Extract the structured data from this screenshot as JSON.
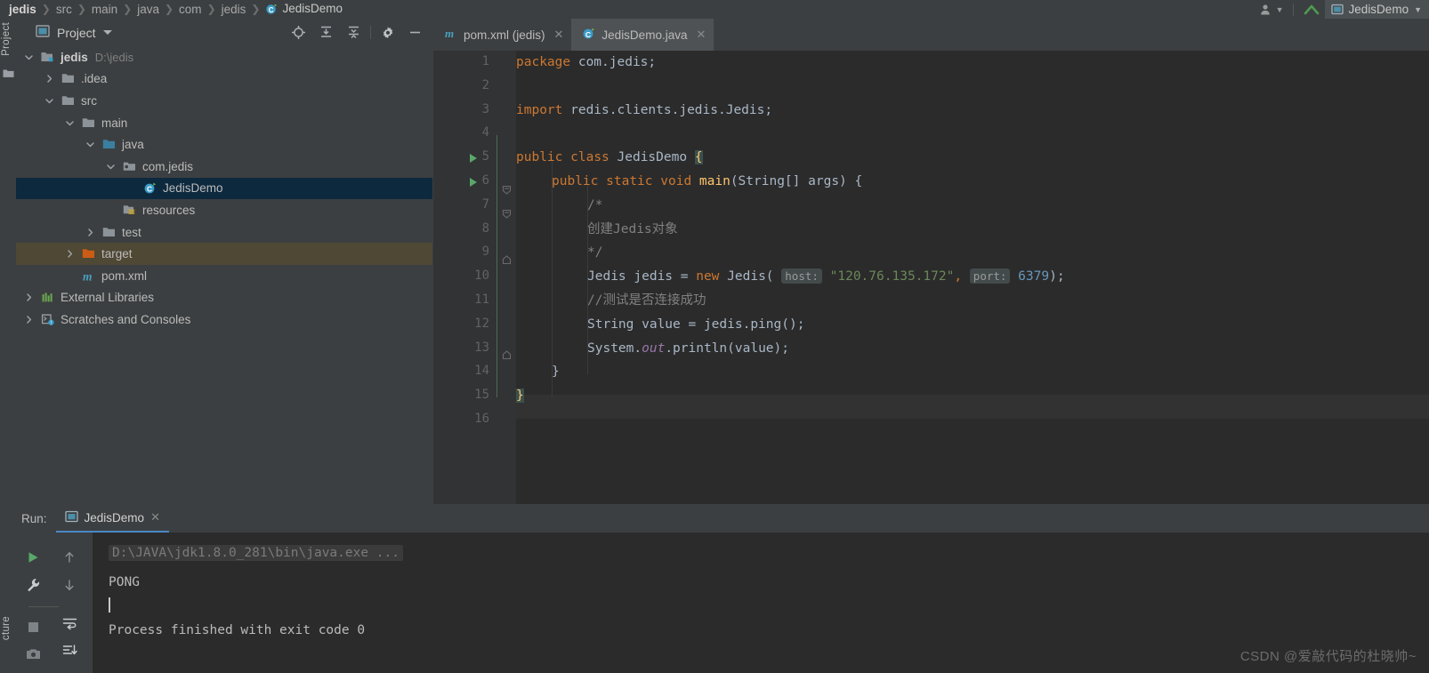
{
  "window": {
    "breadcrumbs": [
      "jedis",
      "src",
      "main",
      "java",
      "com",
      "jedis",
      "JedisDemo"
    ],
    "run_config_name": "JedisDemo",
    "accent_blue": "#4a88c7",
    "selection_navy": "#0d293e",
    "target_highlight": "#4e4834",
    "editor_bg": "#2b2b2b",
    "panel_bg": "#3c3f41"
  },
  "rail": {
    "project_label": "Project",
    "structure_label": "cture"
  },
  "project_panel": {
    "title": "Project",
    "tools": [
      "locate-icon",
      "expand-all-icon",
      "collapse-all-icon",
      "settings-icon",
      "hide-icon"
    ],
    "tree": [
      {
        "indent": 0,
        "arrow": "down",
        "icon": "module-folder",
        "label": "jedis",
        "bold": true,
        "location": "D:\\jedis",
        "state": "normal"
      },
      {
        "indent": 1,
        "arrow": "right",
        "icon": "folder",
        "label": ".idea",
        "bold": false,
        "location": "",
        "state": "normal"
      },
      {
        "indent": 1,
        "arrow": "down",
        "icon": "folder",
        "label": "src",
        "bold": false,
        "location": "",
        "state": "normal"
      },
      {
        "indent": 2,
        "arrow": "down",
        "icon": "folder",
        "label": "main",
        "bold": false,
        "location": "",
        "state": "normal"
      },
      {
        "indent": 3,
        "arrow": "down",
        "icon": "source-folder",
        "label": "java",
        "bold": false,
        "location": "",
        "state": "normal"
      },
      {
        "indent": 4,
        "arrow": "down",
        "icon": "package",
        "label": "com.jedis",
        "bold": false,
        "location": "",
        "state": "normal"
      },
      {
        "indent": 5,
        "arrow": "none",
        "icon": "java-class",
        "label": "JedisDemo",
        "bold": false,
        "location": "",
        "state": "selected"
      },
      {
        "indent": 4,
        "arrow": "none",
        "icon": "resource-folder",
        "label": "resources",
        "bold": false,
        "location": "",
        "state": "normal"
      },
      {
        "indent": 3,
        "arrow": "right",
        "icon": "folder",
        "label": "test",
        "bold": false,
        "location": "",
        "state": "normal"
      },
      {
        "indent": 2,
        "arrow": "right",
        "icon": "target-folder",
        "label": "target",
        "bold": false,
        "location": "",
        "state": "target"
      },
      {
        "indent": 2,
        "arrow": "none",
        "icon": "maven-file",
        "label": "pom.xml",
        "bold": false,
        "location": "",
        "state": "normal"
      },
      {
        "indent": 0,
        "arrow": "right",
        "icon": "libraries",
        "label": "External Libraries",
        "bold": false,
        "location": "",
        "state": "normal"
      },
      {
        "indent": 0,
        "arrow": "right",
        "icon": "scratches",
        "label": "Scratches and Consoles",
        "bold": false,
        "location": "",
        "state": "normal"
      }
    ]
  },
  "editor": {
    "tabs": [
      {
        "label": "pom.xml (jedis)",
        "icon": "maven-file",
        "active": false
      },
      {
        "label": "JedisDemo.java",
        "icon": "java-class",
        "active": true
      }
    ],
    "current_line": 15,
    "gutter_run_lines": [
      5,
      6
    ],
    "lines": [
      {
        "n": 1,
        "indent": 0
      },
      {
        "n": 2,
        "indent": 0
      },
      {
        "n": 3,
        "indent": 0
      },
      {
        "n": 4,
        "indent": 0
      },
      {
        "n": 5,
        "indent": 0
      },
      {
        "n": 6,
        "indent": 1
      },
      {
        "n": 7,
        "indent": 2
      },
      {
        "n": 8,
        "indent": 2
      },
      {
        "n": 9,
        "indent": 2
      },
      {
        "n": 10,
        "indent": 2
      },
      {
        "n": 11,
        "indent": 2
      },
      {
        "n": 12,
        "indent": 2
      },
      {
        "n": 13,
        "indent": 2
      },
      {
        "n": 14,
        "indent": 1
      },
      {
        "n": 15,
        "indent": 0
      },
      {
        "n": 16,
        "indent": 0
      }
    ],
    "code": {
      "l1_kw": "package",
      "l1_rest": " com.jedis;",
      "l3_kw": "import",
      "l3_rest": " redis.clients.jedis.Jedis;",
      "l5_kw1": "public",
      "l5_kw2": "class",
      "l5_name": "JedisDemo",
      "l5_brace": "{",
      "l6_kw1": "public",
      "l6_kw2": "static",
      "l6_kw3": "void",
      "l6_name": "main",
      "l6_rest": "(String[] args) {",
      "l7": "/*",
      "l8": "创建Jedis对象",
      "l9": "*/",
      "l10_type": "Jedis jedis = ",
      "l10_new": "new",
      "l10_ctor": " Jedis(",
      "l10_hint_host": "host:",
      "l10_host": "\"120.76.135.172\"",
      "l10_comma": ",",
      "l10_hint_port": "port:",
      "l10_port": "6379",
      "l10_tail": ");",
      "l11": "//测试是否连接成功",
      "l12": "String value = jedis.ping();",
      "l13_a": "System.",
      "l13_out": "out",
      "l13_b": ".println(value);",
      "l14": "}",
      "l15": "}"
    }
  },
  "run_panel": {
    "run_label": "Run:",
    "tab_label": "JedisDemo",
    "side_buttons": [
      "rerun-icon",
      "wrench-icon",
      "stop-icon",
      "camera-icon",
      "scroll-up-icon",
      "scroll-down-icon",
      "soft-wrap-icon",
      "print-icon"
    ],
    "console": {
      "command": "D:\\JAVA\\jdk1.8.0_281\\bin\\java.exe ...",
      "output": "PONG",
      "finished": "Process finished with exit code 0"
    }
  },
  "watermark": "CSDN @爱敲代码的杜晓帅~"
}
